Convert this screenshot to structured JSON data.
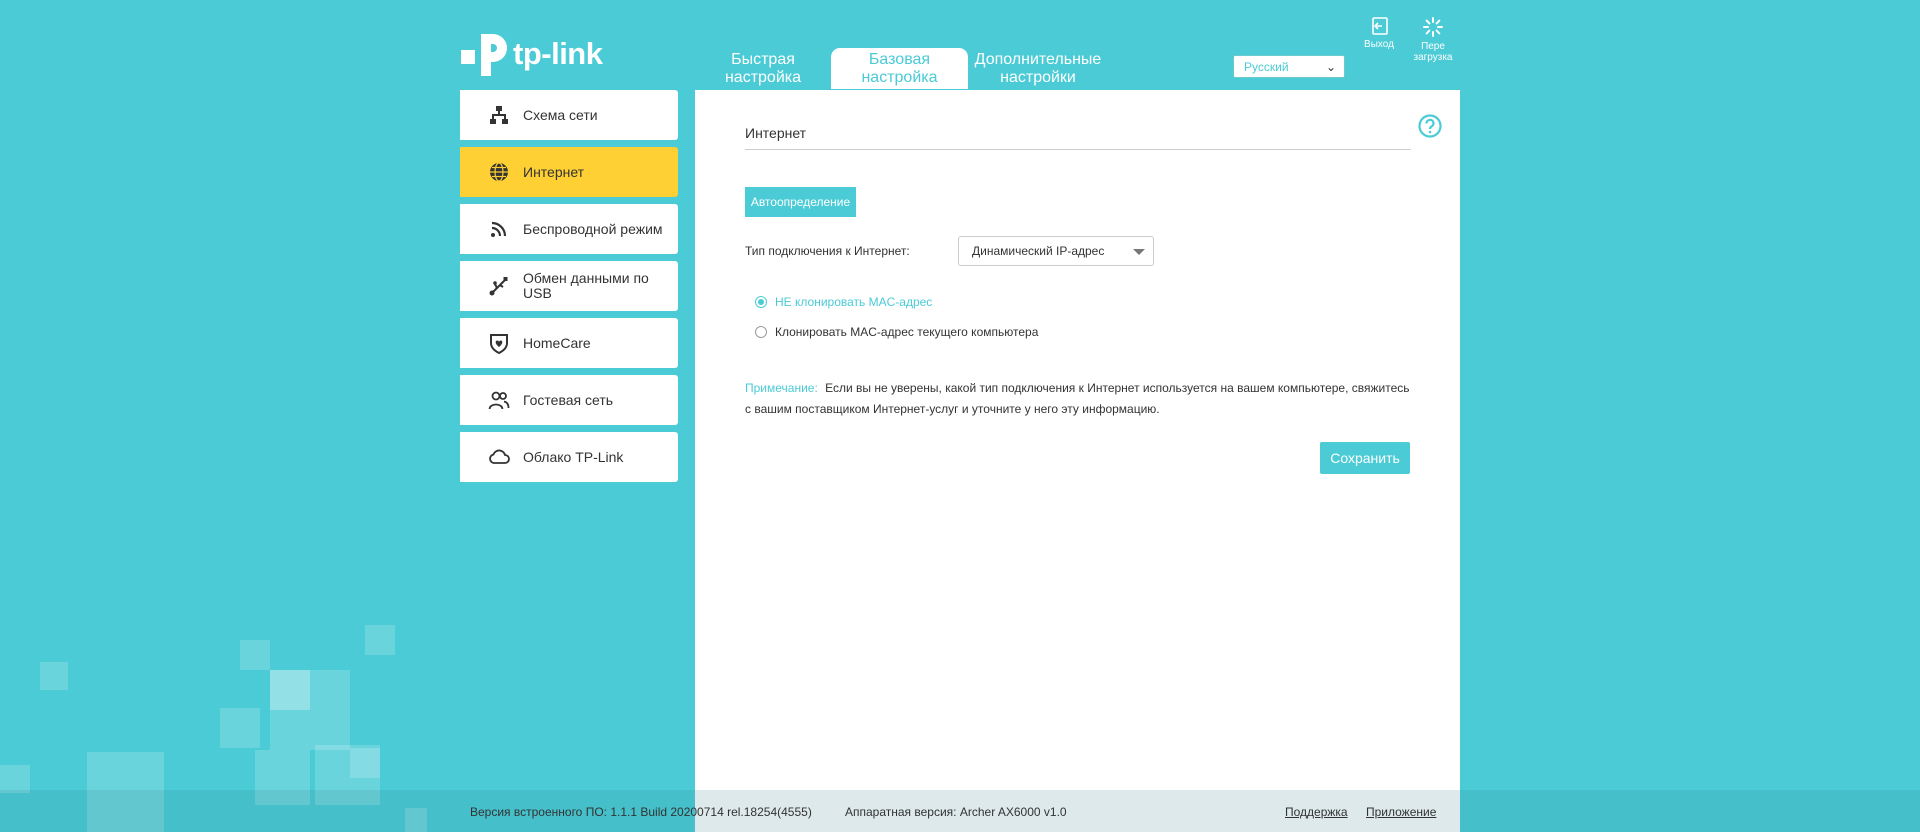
{
  "brand": {
    "name": "tp-link",
    "color": "#4acbd6",
    "active_color": "#fed033"
  },
  "header": {
    "tabs": [
      {
        "label": "Быстрая настройка",
        "active": false
      },
      {
        "label": "Базовая настройка",
        "active": true
      },
      {
        "label": "Дополнительные настройки",
        "active": false
      }
    ],
    "language": "Русский",
    "logout_label": "Выход",
    "reboot_label": "Пере загрузка"
  },
  "sidebar": {
    "items": [
      {
        "label": "Схема сети",
        "icon": "network-map-icon"
      },
      {
        "label": "Интернет",
        "icon": "globe-icon",
        "active": true
      },
      {
        "label": "Беспроводной режим",
        "icon": "wireless-icon"
      },
      {
        "label": "Обмен данными по USB",
        "icon": "usb-icon"
      },
      {
        "label": "HomeCare",
        "icon": "homecare-shield-icon"
      },
      {
        "label": "Гостевая сеть",
        "icon": "guest-users-icon"
      },
      {
        "label": "Облако TP-Link",
        "icon": "cloud-icon"
      }
    ]
  },
  "main": {
    "title": "Интернет",
    "autodetect_label": "Автоопределение",
    "connection_type_label": "Тип подключения к Интернет:",
    "connection_type_value": "Динамический IP-адрес",
    "radio_options": [
      {
        "label": "НЕ клонировать MAC-адрес",
        "checked": true
      },
      {
        "label": "Клонировать MAC-адрес текущего компьютера",
        "checked": false
      }
    ],
    "note_label": "Примечание:",
    "note_text": "Если вы не уверены, какой тип подключения к Интернет используется на вашем компьютере, свяжитесь с вашим поставщиком Интернет-услуг и уточните у него эту информацию.",
    "save_label": "Сохранить"
  },
  "footer": {
    "firmware": "Версия встроенного ПО: 1.1.1 Build 20200714 rel.18254(4555)",
    "hardware": "Аппаратная версия: Archer AX6000 v1.0",
    "support_label": "Поддержка",
    "app_label": "Приложение"
  }
}
